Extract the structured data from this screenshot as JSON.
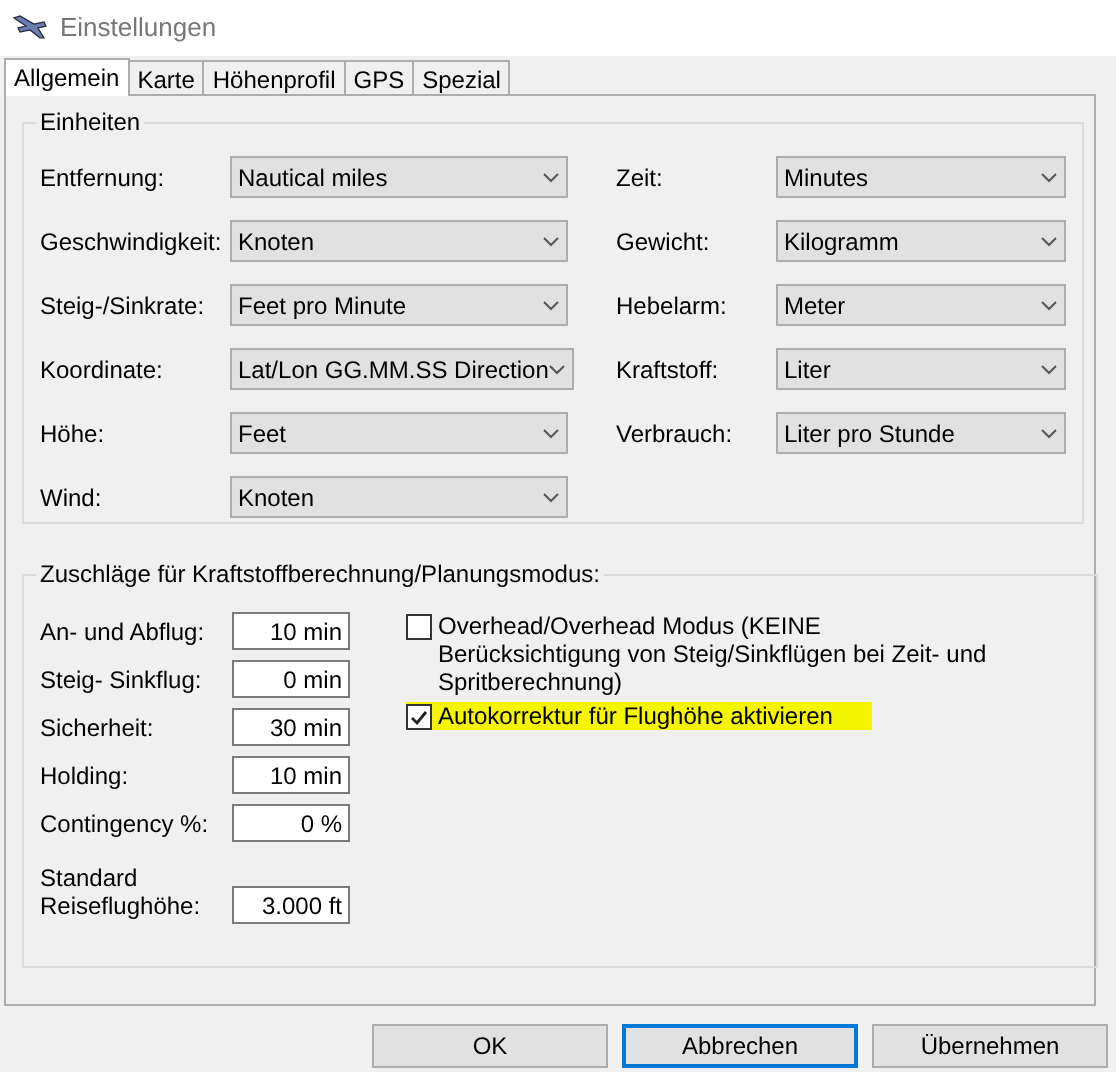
{
  "window": {
    "title": "Einstellungen"
  },
  "tabs": [
    {
      "label": "Allgemein",
      "selected": true
    },
    {
      "label": "Karte",
      "selected": false
    },
    {
      "label": "Höhenprofil",
      "selected": false
    },
    {
      "label": "GPS",
      "selected": false
    },
    {
      "label": "Spezial",
      "selected": false
    }
  ],
  "units": {
    "title": "Einheiten",
    "left": [
      {
        "label": "Entfernung:",
        "value": "Nautical miles"
      },
      {
        "label": "Geschwindigkeit:",
        "value": "Knoten"
      },
      {
        "label": "Steig-/Sinkrate:",
        "value": "Feet pro Minute"
      },
      {
        "label": "Koordinate:",
        "value": "Lat/Lon GG.MM.SS Direction"
      },
      {
        "label": "Höhe:",
        "value": "Feet"
      },
      {
        "label": "Wind:",
        "value": "Knoten"
      }
    ],
    "right": [
      {
        "label": "Zeit:",
        "value": "Minutes"
      },
      {
        "label": "Gewicht:",
        "value": "Kilogramm"
      },
      {
        "label": "Hebelarm:",
        "value": "Meter"
      },
      {
        "label": "Kraftstoff:",
        "value": "Liter"
      },
      {
        "label": "Verbrauch:",
        "value": "Liter pro Stunde"
      }
    ]
  },
  "surcharges": {
    "title": "Zuschläge für Kraftstoffberechnung/Planungsmodus:",
    "fields": [
      {
        "label": "An- und Abflug:",
        "value": "10 min"
      },
      {
        "label": "Steig- Sinkflug:",
        "value": "0 min"
      },
      {
        "label": "Sicherheit:",
        "value": "30 min"
      },
      {
        "label": "Holding:",
        "value": "10 min"
      },
      {
        "label": "Contingency %:",
        "value": "0 %"
      },
      {
        "label": "Standard Reiseflughöhe:",
        "value": "3.000 ft"
      }
    ],
    "options": [
      {
        "label": "Overhead/Overhead Modus (KEINE Berücksichtigung von Steig/Sinkflügen bei Zeit- und Spritberechnung)",
        "checked": false,
        "highlighted": false
      },
      {
        "label": "Autokorrektur für Flughöhe aktivieren",
        "checked": true,
        "highlighted": true
      }
    ]
  },
  "buttons": [
    {
      "label": "OK",
      "focused": false
    },
    {
      "label": "Abbrechen",
      "focused": true
    },
    {
      "label": "Übernehmen",
      "focused": false
    }
  ]
}
